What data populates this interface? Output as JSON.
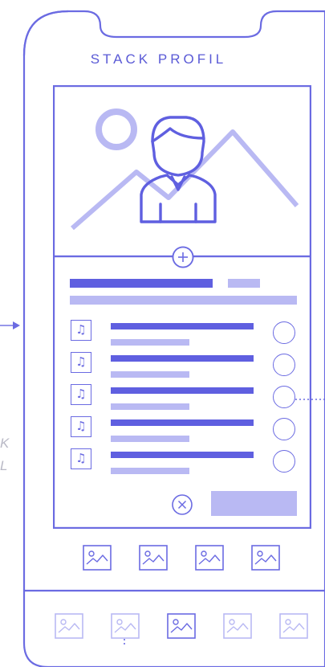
{
  "colors": {
    "accent": "#6b6be2",
    "accent_dark": "#5f5fe0",
    "accent_light": "#b9b9f3",
    "muted": "#b9b9c6"
  },
  "header": {
    "title": "STACK PROFIL"
  },
  "side_labels": {
    "line1": "K",
    "line2": "L"
  },
  "profile": {
    "avatar_icon": "user-avatar-icon",
    "background_icon": "landscape-icon",
    "add_icon": "plus-circle-icon"
  },
  "tracks": [
    {
      "icon": "music-note-icon",
      "glyph": "♫"
    },
    {
      "icon": "music-note-icon",
      "glyph": "♫"
    },
    {
      "icon": "music-note-icon",
      "glyph": "♫"
    },
    {
      "icon": "music-note-icon",
      "glyph": "♫"
    },
    {
      "icon": "music-note-icon",
      "glyph": "♫"
    }
  ],
  "actions": {
    "close_icon": "close-circle-icon",
    "close_glyph": "×"
  },
  "gallery": {
    "thumb_icon": "image-icon",
    "count": 4
  },
  "tab_bar": {
    "thumb_icon": "image-icon",
    "count": 5,
    "selected": 2
  }
}
